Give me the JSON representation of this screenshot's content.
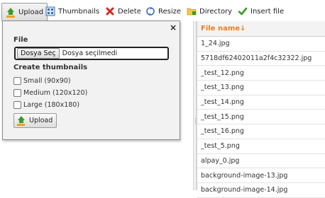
{
  "toolbar": {
    "upload": "Upload",
    "thumbnails": "Thumbnails",
    "delete": "Delete",
    "resize": "Resize",
    "directory": "Directory",
    "insert_file": "Insert file"
  },
  "popup": {
    "close": "×",
    "file_label": "File",
    "file_button": "Dosya Seç",
    "file_status": "Dosya seçilmedi",
    "thumbs_label": "Create thumbnails",
    "options": [
      {
        "label": "Small (90x90)",
        "checked": false
      },
      {
        "label": "Medium (120x120)",
        "checked": false
      },
      {
        "label": "Large (180x180)",
        "checked": false
      }
    ],
    "upload_button": "Upload"
  },
  "list": {
    "header": "File name",
    "sort_indicator": "↓",
    "files": [
      "1_24.jpg",
      "5718df62402011a2f4c32322.jpg",
      "_test_12.png",
      "_test_13.png",
      "_test_14.png",
      "_test_15.png",
      "_test_16.png",
      "_test_5.png",
      "alpay_0.jpg",
      "background-image-13.jpg",
      "background-image-14.jpg"
    ]
  },
  "colors": {
    "header_text": "#f07d1a",
    "delete_icon": "#d42a1c",
    "check_icon": "#3a9d23"
  }
}
